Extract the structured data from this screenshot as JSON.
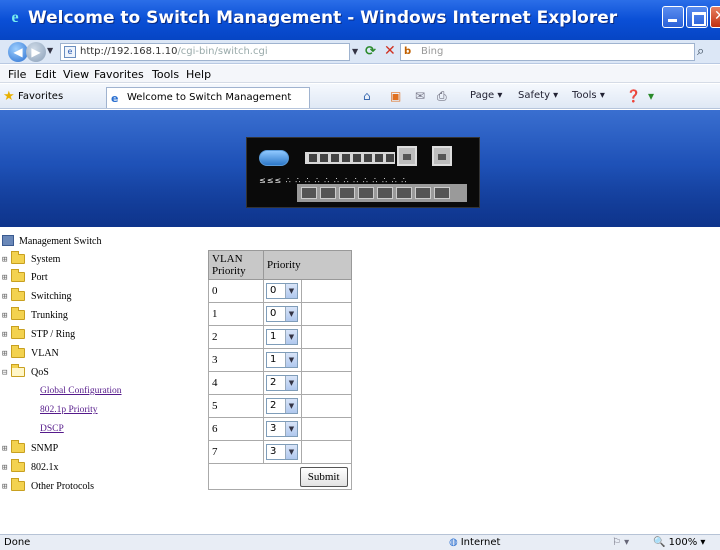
{
  "window": {
    "title": "Welcome to Switch Management - Windows Internet Explorer"
  },
  "address": {
    "url_host": "http://192.168.1.10",
    "url_path": "/cgi-bin/switch.cgi",
    "search_engine": "Bing"
  },
  "menu": [
    "File",
    "Edit",
    "View",
    "Favorites",
    "Tools",
    "Help"
  ],
  "favorites_bar": {
    "label": "Favorites",
    "tab_title": "Welcome to Switch Management",
    "commands": [
      "Page",
      "Safety",
      "Tools"
    ]
  },
  "tree": {
    "root": "Management Switch",
    "nodes": [
      {
        "label": "System",
        "expanded": false
      },
      {
        "label": "Port",
        "expanded": false
      },
      {
        "label": "Switching",
        "expanded": false
      },
      {
        "label": "Trunking",
        "expanded": false
      },
      {
        "label": "STP / Ring",
        "expanded": false
      },
      {
        "label": "VLAN",
        "expanded": false
      },
      {
        "label": "QoS",
        "expanded": true
      },
      {
        "label": "SNMP",
        "expanded": false
      },
      {
        "label": "802.1x",
        "expanded": false
      },
      {
        "label": "Other Protocols",
        "expanded": false
      }
    ],
    "qos_children": [
      "Global Configuration",
      "802.1p Priority",
      "DSCP"
    ]
  },
  "qos_table": {
    "col1_header": "VLAN Priority",
    "col2_header": "Priority",
    "rows": [
      {
        "vlan_priority": "0",
        "priority": "0"
      },
      {
        "vlan_priority": "1",
        "priority": "0"
      },
      {
        "vlan_priority": "2",
        "priority": "1"
      },
      {
        "vlan_priority": "3",
        "priority": "1"
      },
      {
        "vlan_priority": "4",
        "priority": "2"
      },
      {
        "vlan_priority": "5",
        "priority": "2"
      },
      {
        "vlan_priority": "6",
        "priority": "3"
      },
      {
        "vlan_priority": "7",
        "priority": "3"
      }
    ],
    "submit_label": "Submit"
  },
  "status": {
    "left": "Done",
    "zone": "Internet",
    "zoom": "100%"
  },
  "colors": {
    "titlebar": "#0a4fd6",
    "banner": "#1f52b8",
    "table_header": "#c8c8c8",
    "visited_link": "#551a8b"
  }
}
